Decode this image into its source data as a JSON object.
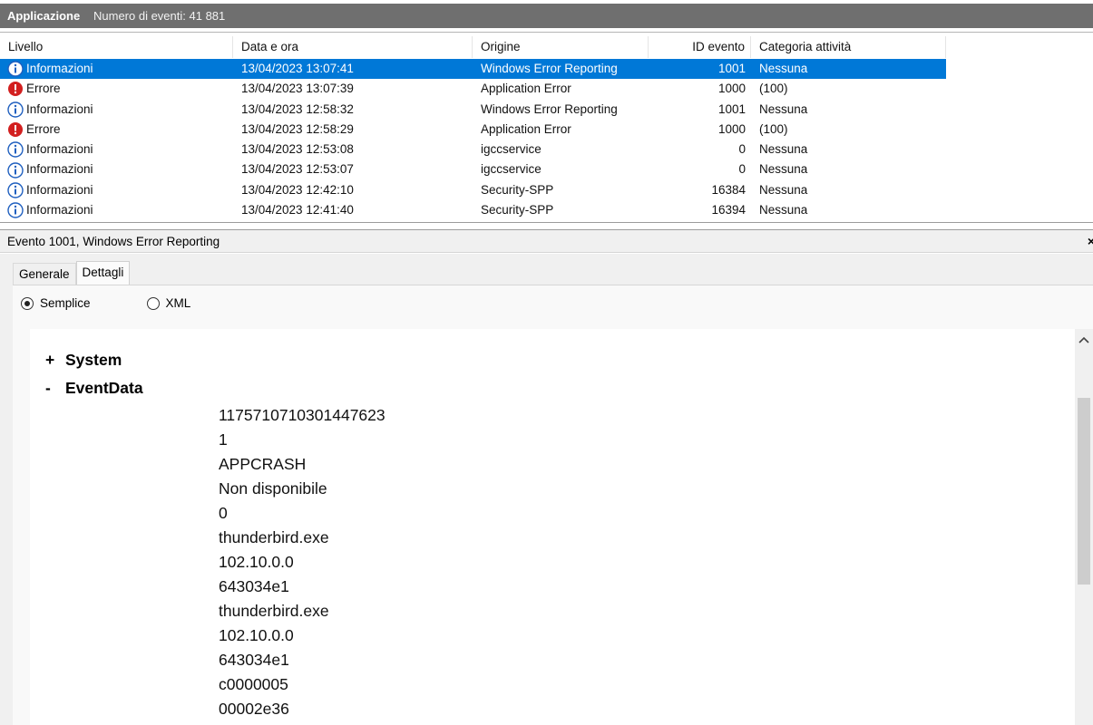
{
  "titlebar": {
    "title": "Applicazione",
    "event_count": "Numero di eventi: 41 881"
  },
  "table": {
    "columns": [
      "Livello",
      "Data e ora",
      "Origine",
      "ID evento",
      "Categoria attività"
    ],
    "rows": [
      {
        "level": "Informazioni",
        "icon": "info-icon",
        "datetime": "13/04/2023 13:07:41",
        "source": "Windows Error Reporting",
        "id": "1001",
        "category": "Nessuna",
        "selected": true
      },
      {
        "level": "Errore",
        "icon": "error-icon",
        "datetime": "13/04/2023 13:07:39",
        "source": "Application Error",
        "id": "1000",
        "category": "(100)"
      },
      {
        "level": "Informazioni",
        "icon": "info-icon",
        "datetime": "13/04/2023 12:58:32",
        "source": "Windows Error Reporting",
        "id": "1001",
        "category": "Nessuna"
      },
      {
        "level": "Errore",
        "icon": "error-icon",
        "datetime": "13/04/2023 12:58:29",
        "source": "Application Error",
        "id": "1000",
        "category": "(100)"
      },
      {
        "level": "Informazioni",
        "icon": "info-icon",
        "datetime": "13/04/2023 12:53:08",
        "source": "igccservice",
        "id": "0",
        "category": "Nessuna"
      },
      {
        "level": "Informazioni",
        "icon": "info-icon",
        "datetime": "13/04/2023 12:53:07",
        "source": "igccservice",
        "id": "0",
        "category": "Nessuna"
      },
      {
        "level": "Informazioni",
        "icon": "info-icon",
        "datetime": "13/04/2023 12:42:10",
        "source": "Security-SPP",
        "id": "16384",
        "category": "Nessuna"
      },
      {
        "level": "Informazioni",
        "icon": "info-icon",
        "datetime": "13/04/2023 12:41:40",
        "source": "Security-SPP",
        "id": "16394",
        "category": "Nessuna"
      }
    ]
  },
  "detail": {
    "title": "Evento 1001, Windows Error Reporting",
    "close": "×",
    "tabs": [
      {
        "label": "Generale",
        "active": false
      },
      {
        "label": "Dettagli",
        "active": true
      }
    ],
    "view": {
      "simple_label": "Semplice",
      "xml_label": "XML",
      "selected": "simple"
    },
    "system": {
      "sign": "+",
      "label": "System"
    },
    "eventdata": {
      "sign": "-",
      "label": "EventData",
      "values": [
        "1175710710301447623",
        "1",
        "APPCRASH",
        "Non disponibile",
        "0",
        "thunderbird.exe",
        "102.10.0.0",
        "643034e1",
        "thunderbird.exe",
        "102.10.0.0",
        "643034e1",
        "c0000005",
        "00002e36"
      ]
    }
  },
  "colors": {
    "selection": "#0078d7",
    "titlebar": "#6f6f6f",
    "info_blue": "#1f5fbf",
    "error_red": "#d21f1f"
  }
}
